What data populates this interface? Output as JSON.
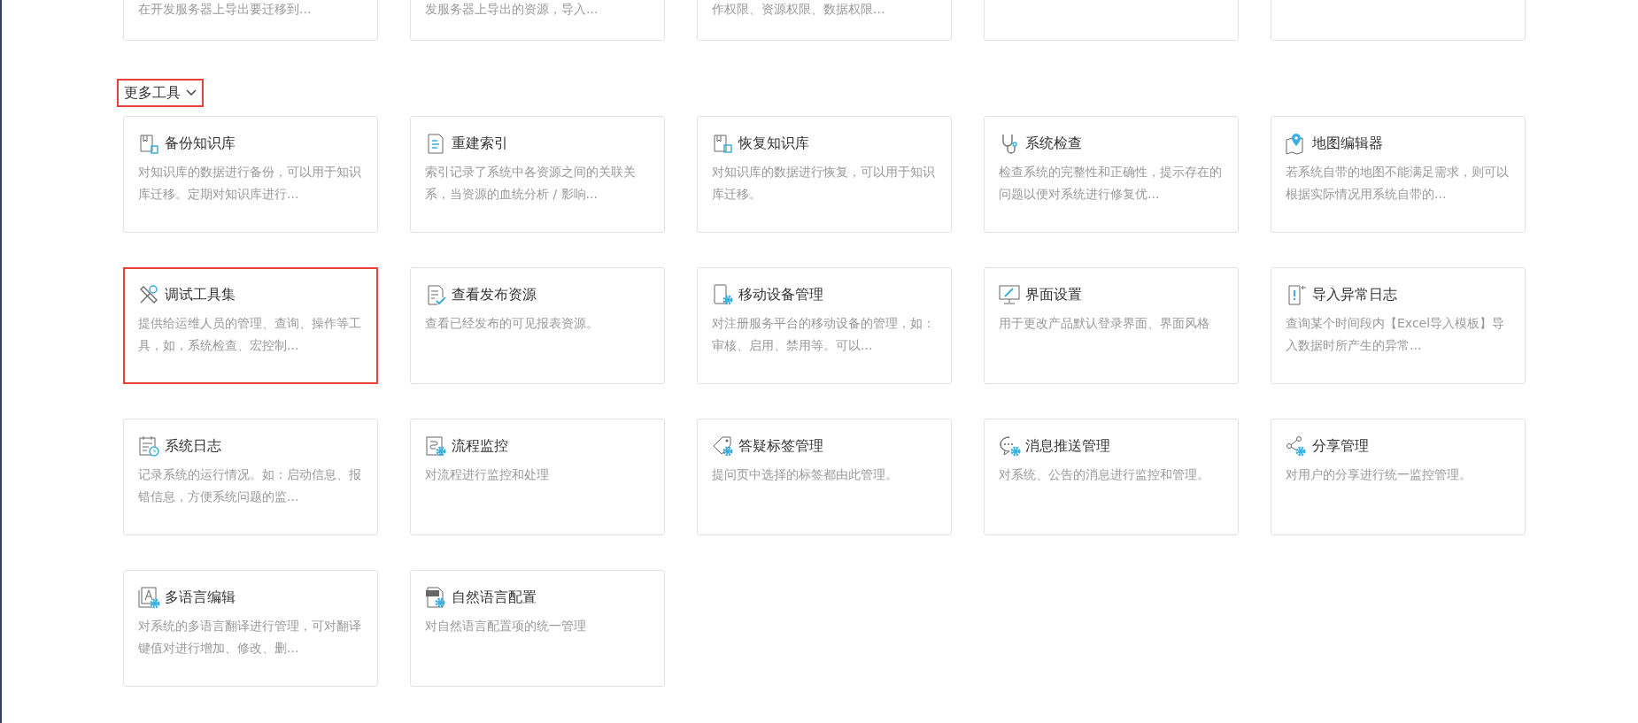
{
  "top_cards": [
    {
      "kind": "text",
      "description": "在开发服务器上导出要迁移到..."
    },
    {
      "kind": "text",
      "description": "发服务器上导出的资源，导入..."
    },
    {
      "kind": "text",
      "description": "作权限、资源权限、数据权限..."
    },
    {
      "kind": "blank"
    },
    {
      "kind": "blank"
    }
  ],
  "section": {
    "title": "更多工具",
    "expanded": true,
    "highlighted": true
  },
  "cards": [
    {
      "title": "备份知识库",
      "description": "对知识库的数据进行备份，可以用于知识库迁移。定期对知识库进行...",
      "highlighted": false
    },
    {
      "title": "重建索引",
      "description": "索引记录了系统中各资源之间的关联关系，当资源的血统分析 / 影响...",
      "highlighted": false
    },
    {
      "title": "恢复知识库",
      "description": "对知识库的数据进行恢复，可以用于知识库迁移。",
      "highlighted": false
    },
    {
      "title": "系统检查",
      "description": "检查系统的完整性和正确性，提示存在的问题以便对系统进行修复优...",
      "highlighted": false
    },
    {
      "title": "地图编辑器",
      "description": "若系统自带的地图不能满足需求，则可以根据实际情况用系统自带的...",
      "highlighted": false
    },
    {
      "title": "调试工具集",
      "description": "提供给运维人员的管理、查询、操作等工具，如，系统检查、宏控制...",
      "highlighted": true
    },
    {
      "title": "查看发布资源",
      "description": "查看已经发布的可见报表资源。",
      "highlighted": false
    },
    {
      "title": "移动设备管理",
      "description": "对注册服务平台的移动设备的管理，如：审核、启用、禁用等。可以...",
      "highlighted": false
    },
    {
      "title": "界面设置",
      "description": "用于更改产品默认登录界面、界面风格",
      "highlighted": false
    },
    {
      "title": "导入异常日志",
      "description": "查询某个时间段内【Excel导入模板】导入数据时所产生的异常...",
      "highlighted": false
    },
    {
      "title": "系统日志",
      "description": "记录系统的运行情况。如：启动信息、报错信息，方便系统问题的监...",
      "highlighted": false
    },
    {
      "title": "流程监控",
      "description": "对流程进行监控和处理",
      "highlighted": false
    },
    {
      "title": "答疑标签管理",
      "description": "提问页中选择的标签都由此管理。",
      "highlighted": false
    },
    {
      "title": "消息推送管理",
      "description": "对系统、公告的消息进行监控和管理。",
      "highlighted": false
    },
    {
      "title": "分享管理",
      "description": "对用户的分享进行统一监控管理。",
      "highlighted": false
    },
    {
      "title": "多语言编辑",
      "description": "对系统的多语言翻译进行管理，可对翻译键值对进行增加、修改、删...",
      "highlighted": false
    },
    {
      "title": "自然语言配置",
      "description": "对自然语言配置项的统一管理",
      "highlighted": false
    }
  ]
}
